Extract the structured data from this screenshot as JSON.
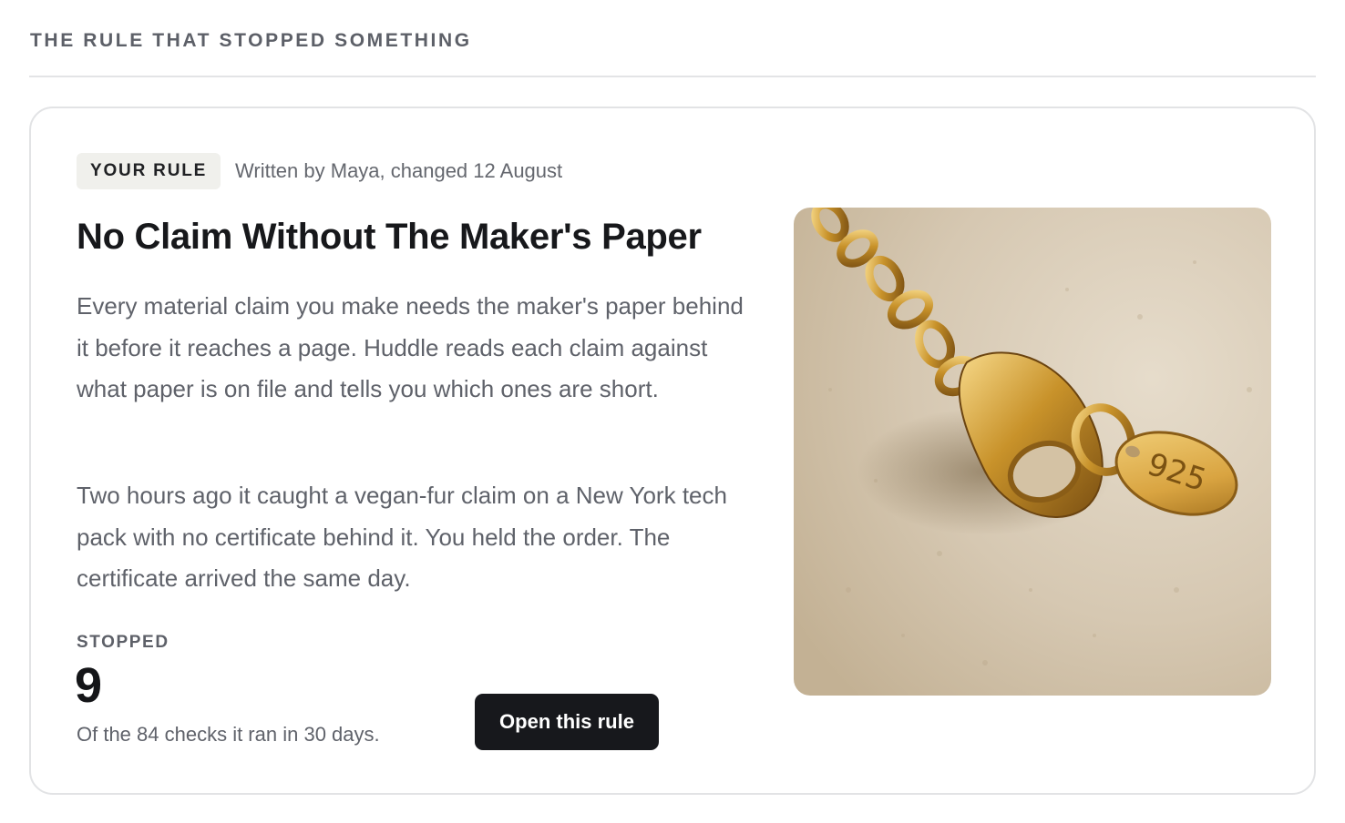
{
  "section": {
    "title": "THE RULE THAT STOPPED SOMETHING"
  },
  "card": {
    "badge": "YOUR RULE",
    "byline": "Written by Maya, changed 12 August",
    "title": "No Claim Without The Maker's Paper",
    "paragraphs": [
      "Every material claim you make needs the maker's paper behind it before it reaches a page. Huddle reads each claim against what paper is on file and tells you which ones are short.",
      "Two hours ago it caught a vegan-fur claim on a New York tech pack with no certificate behind it. You held the order. The certificate arrived the same day."
    ],
    "stat": {
      "label": "STOPPED",
      "value": "9",
      "caption": "Of the 84 checks it ran in 30 days."
    },
    "action": {
      "label": "Open this rule"
    },
    "photo": {
      "tag_text": "925"
    }
  }
}
